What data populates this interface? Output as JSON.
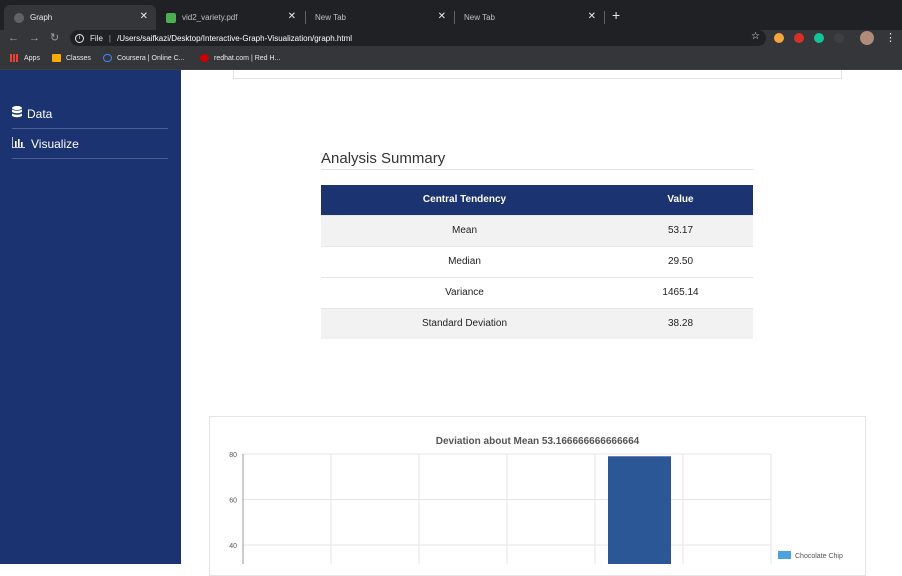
{
  "browser": {
    "tabs": [
      {
        "label": "Graph",
        "active": true,
        "favicon": "globe-icon"
      },
      {
        "label": "vid2_variety.pdf",
        "active": false,
        "favicon": "pdf-icon"
      },
      {
        "label": "New Tab",
        "active": false
      },
      {
        "label": "New Tab",
        "active": false
      }
    ],
    "address": {
      "prefix": "File",
      "url": "/Users/saifkazi/Desktop/Interactive-Graph-Visualization/graph.html"
    },
    "bookmarks": [
      {
        "label": "Apps",
        "icon": "apps-grid-icon"
      },
      {
        "label": "Classes",
        "icon": "folder-icon"
      },
      {
        "label": "Coursera | Online C...",
        "icon": "coursera-icon"
      },
      {
        "label": "redhat.com | Red H...",
        "icon": "redhat-icon"
      }
    ]
  },
  "sidebar": {
    "items": [
      {
        "label": "Data",
        "icon": "database-icon"
      },
      {
        "label": "Visualize",
        "icon": "bar-chart-icon"
      }
    ]
  },
  "summary": {
    "title": "Analysis Summary",
    "headers": [
      "Central Tendency",
      "Value"
    ],
    "rows": [
      [
        "Mean",
        "53.17"
      ],
      [
        "Median",
        "29.50"
      ],
      [
        "Variance",
        "1465.14"
      ],
      [
        "Standard Deviation",
        "38.28"
      ]
    ]
  },
  "colors": {
    "sidebar": "#1b3370",
    "bar": "#2b5797",
    "legend": "#4aa3df"
  },
  "chart_data": {
    "type": "bar",
    "title": "Deviation about Mean 53.166666666666664",
    "y_ticks": [
      "80",
      "60",
      "40"
    ],
    "ylim": [
      0,
      80
    ],
    "categories": [
      "",
      "",
      "",
      "",
      "",
      ""
    ],
    "series": [
      {
        "name": "Chocolate Chip",
        "values": [
          null,
          null,
          null,
          null,
          79,
          null
        ]
      }
    ],
    "legend": "right",
    "grid": true
  }
}
